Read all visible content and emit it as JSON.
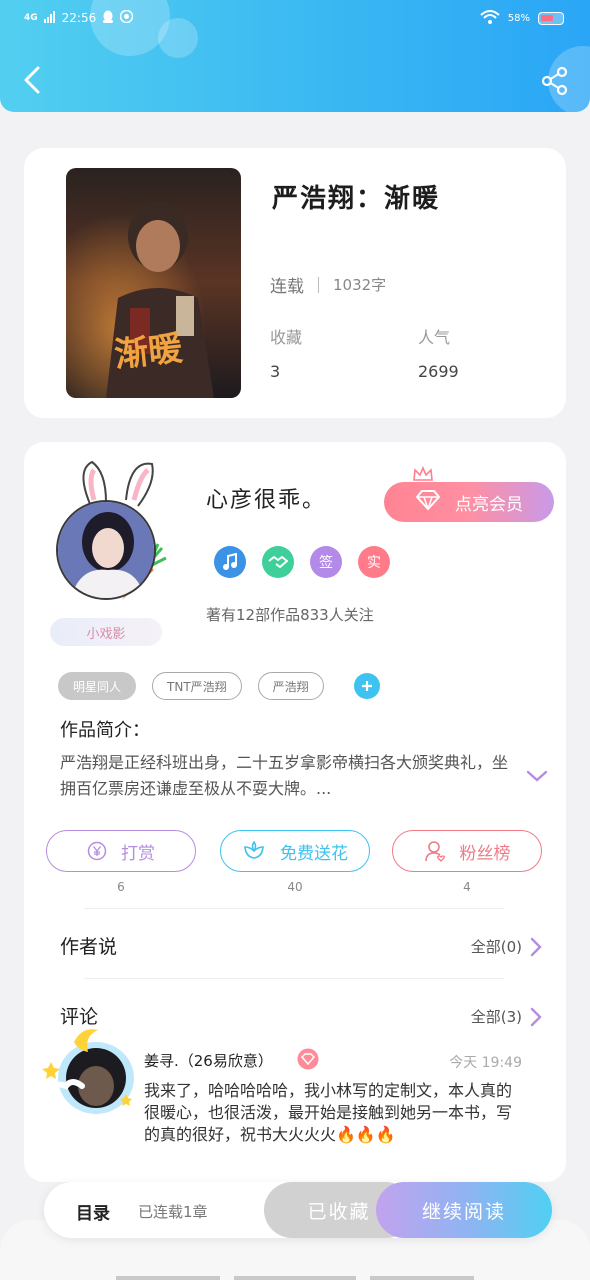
{
  "status_bar": {
    "network": "4G",
    "time": "22:56",
    "battery": "58%"
  },
  "book": {
    "title": "严浩翔：渐暖",
    "cover_text": "渐暖",
    "status": "连载",
    "words": "1032字",
    "favorites_label": "收藏",
    "favorites_value": "3",
    "popularity_label": "人气",
    "popularity_value": "2699"
  },
  "author": {
    "name": "心彦很乖。",
    "vip_button": "点亮会员",
    "badges": [
      {
        "icon": "music-note-icon",
        "text": "",
        "color": "#3b93e6"
      },
      {
        "icon": "handshake-icon",
        "text": "",
        "color": "#3fcf9a"
      },
      {
        "icon": "sign-badge-icon",
        "text": "签",
        "color": "#b48ae8"
      },
      {
        "icon": "verified-badge-icon",
        "text": "实",
        "color": "#ff7b8a"
      }
    ],
    "stats": "著有12部作品833人关注",
    "nickname_tag": "小戏影"
  },
  "tags": [
    "明星同人",
    "TNT严浩翔",
    "严浩翔"
  ],
  "intro": {
    "title": "作品简介：",
    "text": "严浩翔是正经科班出身，二十五岁拿影帝横扫各大颁奖典礼，坐拥百亿票房还谦虚至极从不耍大牌。..."
  },
  "actions": [
    {
      "label": "打赏",
      "count": "6",
      "color": "#b58de0",
      "icon": "yen-icon"
    },
    {
      "label": "免费送花",
      "count": "40",
      "color": "#3ec2ef",
      "icon": "flower-icon"
    },
    {
      "label": "粉丝榜",
      "count": "4",
      "color": "#f07b86",
      "icon": "fan-rank-icon"
    }
  ],
  "author_says": {
    "title": "作者说",
    "all": "全部(0)"
  },
  "comments": {
    "title": "评论",
    "all": "全部(3)",
    "items": [
      {
        "name": "姜寻.（26易欣意）",
        "time": "今天 19:49",
        "text": "我来了，哈哈哈哈哈，我小林写的定制文，本人真的很暖心，也很活泼，最开始是接触到她另一本书，写的真的很好，祝书大火火火🔥🔥🔥"
      }
    ]
  },
  "bottom_bar": {
    "toc": "目录",
    "toc_sub": "已连载1章",
    "collected": "已收藏",
    "continue": "继续阅读"
  }
}
